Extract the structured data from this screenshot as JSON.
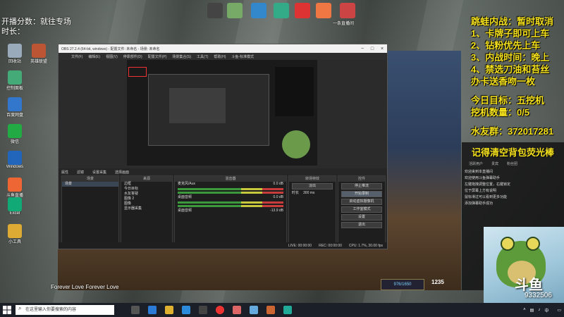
{
  "desktop": {
    "overlay_left": [
      "开播分数：就往专场",
      "时长："
    ],
    "icons": [
      {
        "label": "回收站",
        "color": "#9ab"
      },
      {
        "label": "控制面板",
        "color": "#4a7"
      },
      {
        "label": "英雄联盟",
        "color": "#b53"
      },
      {
        "label": "百度网盘",
        "color": "#37c"
      },
      {
        "label": "微信",
        "color": "#2a4"
      },
      {
        "label": "Windows",
        "color": "#26b"
      },
      {
        "label": "斗鱼直播",
        "color": "#e63"
      },
      {
        "label": "斗鱼直播伴侣",
        "color": "#e83"
      },
      {
        "label": "Excel",
        "color": "#1a7"
      },
      {
        "label": "小工具",
        "color": "#da3"
      }
    ],
    "top_icons": [
      "",
      "",
      "",
      "",
      "",
      "",
      "",
      "",
      "一条直播间"
    ]
  },
  "info_panel": {
    "lines": [
      "跳蛙内战：暂时取消",
      "1、卡牌子即可上车",
      "2、钻粉优先上车",
      "3、内战时间：晚上",
      "4、禁选刀油和苔丝",
      "办卡送香吻一枚",
      "",
      "今日目标：五挖机",
      "挖机数量：0/5",
      "",
      "水友群：372017281"
    ]
  },
  "chat": {
    "title": "记得清空背包荧光棒",
    "tabs": [
      "活跃用户",
      "贵宾",
      "粉丝团"
    ],
    "messages": [
      "欢迎来到本直播间",
      "欢迎使用斗鱼弹幕助手",
      "左键拖拽调整位置，右键锁定",
      "位于屏幕上方有说明",
      "鼠标滑过可以看到更多功能",
      "添加弹幕助手成功"
    ],
    "cam_logo": "斗鱼",
    "cam_number": "9332506"
  },
  "obs": {
    "title": "OBS 27.2.4 (64-bit, windows) - 配置文件: 未命名 - 场景: 未命名",
    "menu": [
      "文件(F)",
      "编辑(E)",
      "视图(V)",
      "停靠部件(D)",
      "配置文件(P)",
      "场景集合(S)",
      "工具(T)",
      "帮助(H)",
      "斗鱼-标准模式"
    ],
    "scene_toolbar": [
      "属性",
      "滤镜",
      "设置采集",
      "选择画面"
    ],
    "docks": {
      "scenes": {
        "title": "场景",
        "items": [
          "场景"
        ]
      },
      "sources": {
        "title": "来源",
        "items": [
          "边框",
          "今日目标",
          "水友答疑",
          "图像 2",
          "图像",
          "显示器采集"
        ]
      },
      "mixer": {
        "title": "混音器",
        "tracks": [
          {
            "name": "麦克风/Aux",
            "db": "0.0 dB"
          },
          {
            "name": "桌面音频",
            "db": "0.0 dB"
          },
          {
            "name": "桌面音频",
            "db": "-13.9 dB"
          }
        ]
      },
      "transitions": {
        "title": "转场特效",
        "mode": "淡出",
        "duration_label": "时长",
        "duration": "300 ms"
      },
      "controls": {
        "title": "控件",
        "buttons": [
          "停止推流",
          "开始录制",
          "启动虚拟摄像机",
          "工作室模式",
          "设置",
          "退出"
        ]
      }
    },
    "status": {
      "live": "LIVE: 00:00:00",
      "rec": "REC: 00:00:00",
      "cpu": "CPU: 1.7%, 30.00 fps"
    }
  },
  "game": {
    "hud_value": "976/1650",
    "mana": "1235",
    "caption": "Forever Love Forever Love"
  },
  "taskbar": {
    "search_placeholder": "在这里输入你要搜索的内容",
    "time": "",
    "date": ""
  }
}
